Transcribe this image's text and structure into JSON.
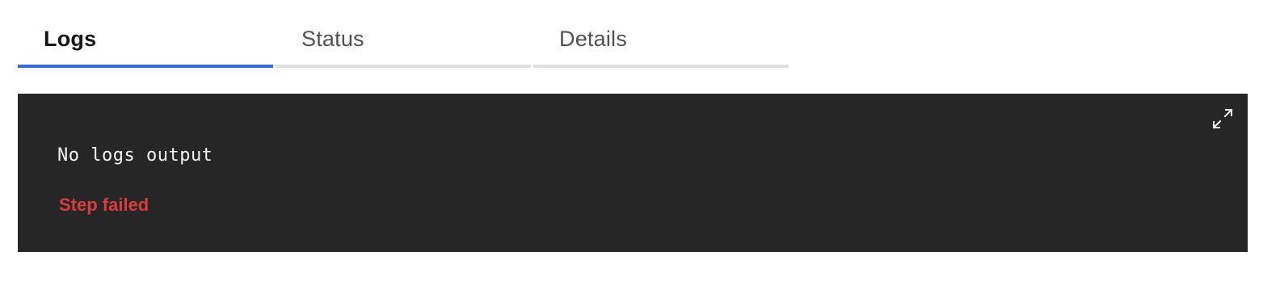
{
  "tabs": [
    {
      "label": "Logs",
      "active": true
    },
    {
      "label": "Status",
      "active": false
    },
    {
      "label": "Details",
      "active": false
    }
  ],
  "log_panel": {
    "output_text": "No logs output",
    "status_text": "Step failed",
    "expand_icon": "maximize-icon"
  },
  "colors": {
    "active_tab_underline": "#2f6de1",
    "inactive_tab_underline": "#e0e0e0",
    "panel_background": "#262626",
    "log_text": "#f4f4f4",
    "error_text": "#da3b3b"
  }
}
